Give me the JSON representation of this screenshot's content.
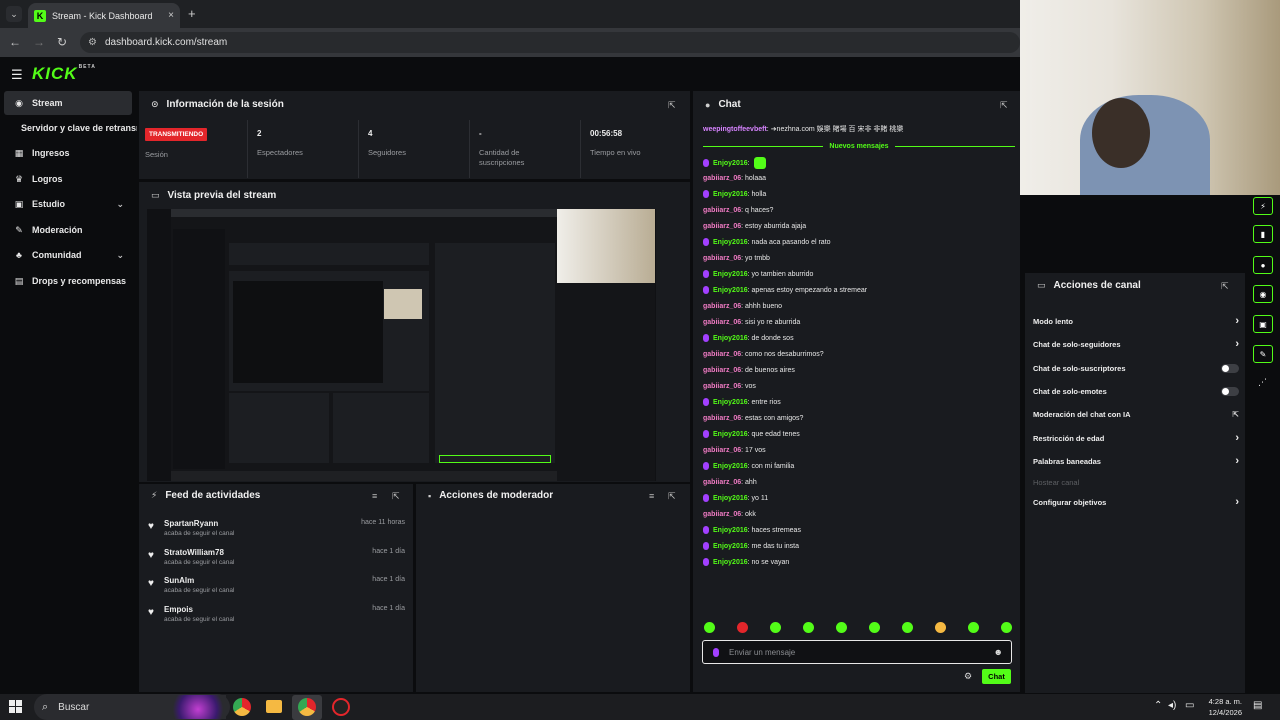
{
  "browser": {
    "tab_title": "Stream - Kick Dashboard",
    "tab_close": "×",
    "new_tab": "+",
    "url": "dashboard.kick.com/stream",
    "back": "←",
    "forward": "→",
    "reload": "↻"
  },
  "header": {
    "logo": "KICK",
    "logo_badge": "BETA"
  },
  "sidebar": {
    "items": [
      {
        "label": "Stream",
        "icon": "stream-icon",
        "active": true
      },
      {
        "label": "Servidor y clave de retransmisión"
      },
      {
        "label": "Ingresos",
        "icon": "money-icon"
      },
      {
        "label": "Logros",
        "icon": "trophy-icon"
      },
      {
        "label": "Estudio",
        "icon": "studio-icon",
        "expandable": true
      },
      {
        "label": "Moderación",
        "icon": "wrench-icon"
      },
      {
        "label": "Comunidad",
        "icon": "community-icon",
        "expandable": true
      },
      {
        "label": "Drops y recompensas",
        "icon": "gift-icon"
      }
    ]
  },
  "session": {
    "title": "Información de la sesión",
    "live_badge": "TRANSMITIENDO",
    "session_label": "Sesión",
    "stats": [
      {
        "value": "2",
        "label": "Espectadores"
      },
      {
        "value": "4",
        "label": "Seguidores"
      },
      {
        "value": "-",
        "label": "Cantidad de suscripciones"
      },
      {
        "value": "00:56:58",
        "label": "Tiempo en vivo"
      }
    ]
  },
  "preview": {
    "title": "Vista previa del stream"
  },
  "feed": {
    "title": "Feed de actividades",
    "items": [
      {
        "name": "SpartanRyann",
        "action": "acaba de seguir el canal",
        "time": "hace 11 horas"
      },
      {
        "name": "StratoWilliam78",
        "action": "acaba de seguir el canal",
        "time": "hace 1 día"
      },
      {
        "name": "SunAlm",
        "action": "acaba de seguir el canal",
        "time": "hace 1 día"
      },
      {
        "name": "Empois",
        "action": "acaba de seguir el canal",
        "time": "hace 1 día"
      }
    ]
  },
  "mod_actions": {
    "title": "Acciones de moderador"
  },
  "chat": {
    "title": "Chat",
    "pinned": {
      "user": "weepingtoffeevbeft",
      "text": "➔nezhna.com 娛樂 賭場 百 宋非 非賭 桃樂"
    },
    "new_messages": "Nuevos mensajes",
    "messages": [
      {
        "user": "Enjoy2016",
        "text": "",
        "color": "green",
        "mic": true,
        "emote": true
      },
      {
        "user": "gabiiarz_06",
        "text": "holaaa",
        "color": "pink"
      },
      {
        "user": "Enjoy2016",
        "text": "holla",
        "color": "green",
        "mic": true
      },
      {
        "user": "gabiiarz_06",
        "text": "q haces?",
        "color": "pink"
      },
      {
        "user": "gabiiarz_06",
        "text": "estoy aburrida ajaja",
        "color": "pink"
      },
      {
        "user": "Enjoy2016",
        "text": "nada aca pasando el rato",
        "color": "green",
        "mic": true
      },
      {
        "user": "gabiiarz_06",
        "text": "yo tmbb",
        "color": "pink"
      },
      {
        "user": "Enjoy2016",
        "text": "yo tambien aburrido",
        "color": "green",
        "mic": true
      },
      {
        "user": "Enjoy2016",
        "text": "apenas estoy empezando a stremear",
        "color": "green",
        "mic": true
      },
      {
        "user": "gabiiarz_06",
        "text": "ahhh bueno",
        "color": "pink"
      },
      {
        "user": "gabiiarz_06",
        "text": "sisi yo re aburrida",
        "color": "pink"
      },
      {
        "user": "Enjoy2016",
        "text": "de donde sos",
        "color": "green",
        "mic": true
      },
      {
        "user": "gabiiarz_06",
        "text": "como nos desaburrimos?",
        "color": "pink"
      },
      {
        "user": "gabiiarz_06",
        "text": "de buenos aires",
        "color": "pink"
      },
      {
        "user": "gabiiarz_06",
        "text": "vos",
        "color": "pink"
      },
      {
        "user": "Enjoy2016",
        "text": "entre rios",
        "color": "green",
        "mic": true
      },
      {
        "user": "gabiiarz_06",
        "text": "estas con amigos?",
        "color": "pink"
      },
      {
        "user": "Enjoy2016",
        "text": "que edad tenes",
        "color": "green",
        "mic": true
      },
      {
        "user": "gabiiarz_06",
        "text": "17 vos",
        "color": "pink"
      },
      {
        "user": "Enjoy2016",
        "text": "con mi familia",
        "color": "green",
        "mic": true
      },
      {
        "user": "gabiiarz_06",
        "text": "ahh",
        "color": "pink"
      },
      {
        "user": "Enjoy2016",
        "text": "yo 11",
        "color": "green",
        "mic": true
      },
      {
        "user": "gabiiarz_06",
        "text": "okk",
        "color": "pink"
      },
      {
        "user": "Enjoy2016",
        "text": "haces stremeas",
        "color": "green",
        "mic": true
      },
      {
        "user": "Enjoy2016",
        "text": "me das tu insta",
        "color": "green",
        "mic": true
      },
      {
        "user": "Enjoy2016",
        "text": "no se vayan",
        "color": "green",
        "mic": true
      }
    ],
    "input_placeholder": "Enviar un mensaje",
    "send_button": "Chat"
  },
  "channel_actions": {
    "title": "Acciones de canal",
    "items": [
      {
        "label": "Modo lento",
        "control": "chevron"
      },
      {
        "label": "Chat de solo-seguidores",
        "control": "chevron"
      },
      {
        "label": "Chat de solo-suscriptores",
        "control": "toggle",
        "on": false
      },
      {
        "label": "Chat de solo-emotes",
        "control": "toggle",
        "on": false
      },
      {
        "label": "Moderación del chat con IA",
        "control": "external"
      },
      {
        "label": "Restricción de edad",
        "control": "chevron"
      },
      {
        "label": "Palabras baneadas",
        "control": "chevron"
      },
      {
        "label": "Hostear canal",
        "control": "none",
        "disabled": true
      },
      {
        "label": "Configurar objetivos",
        "control": "chevron"
      }
    ]
  },
  "taskbar": {
    "search": "Buscar",
    "time": "4:28 a. m.",
    "date": "12/4/2026"
  },
  "colors": {
    "brand": "#53fc18",
    "live": "#e3262b",
    "panel": "#191b1f",
    "bg": "#0b0c0e"
  }
}
